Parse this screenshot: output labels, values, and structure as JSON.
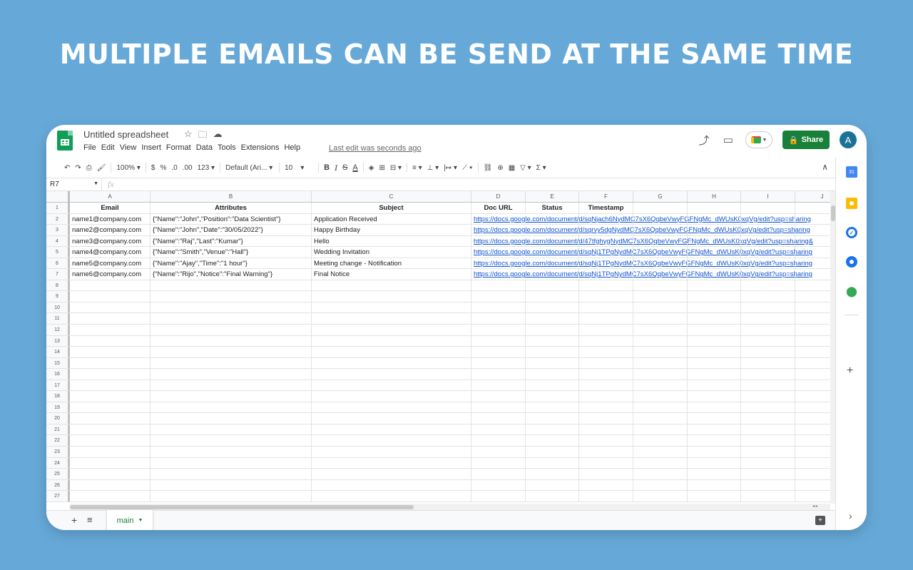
{
  "headline": "MULTIPLE EMAILS CAN BE SEND AT THE SAME TIME",
  "app": {
    "doc_title": "Untitled spreadsheet",
    "menu": [
      "File",
      "Edit",
      "View",
      "Insert",
      "Format",
      "Data",
      "Tools",
      "Extensions",
      "Help"
    ],
    "last_edit": "Last edit was seconds ago",
    "share_label": "Share",
    "avatar_letter": "A",
    "brand_green": "#188038"
  },
  "toolbar": {
    "zoom": "100%",
    "currency": "$",
    "percent": "%",
    "dec_decrease": ".0",
    "dec_increase": ".00",
    "format_more": "123",
    "font": "Default (Ari...",
    "font_size": "10",
    "bold": "B",
    "italic": "I",
    "strike": "S",
    "text_color": "A",
    "functions": "Σ"
  },
  "formula_bar": {
    "cell_ref": "R7",
    "fx": "fx"
  },
  "sheet": {
    "columns": [
      "A",
      "B",
      "C",
      "D",
      "E",
      "F",
      "G",
      "H",
      "I",
      "J"
    ],
    "headers": [
      "Email",
      "Attributes",
      "Subject",
      "Doc URL",
      "Status",
      "Timestamp"
    ],
    "rows": [
      [
        "name1@company.com",
        "{\"Name\":\"John\",\"Position\":\"Data Scientist\"}",
        "Application Received",
        "https://docs.google.com/document/d/sqNjach6NydMC7sX6QqbeVwyFGFNgMc_dWUsK0xqVg/edit?usp=sharing"
      ],
      [
        "name2@company.com",
        "{\"Name\":\"John\",\"Date\":\"30/05/2022\"}",
        "Happy Birthday",
        "https://docs.google.com/document/d/sqrvy5dgNydMC7sX6QqbeVwyFGFNgMc_dWUsK0xqVg/edit?usp=sharing"
      ],
      [
        "name3@company.com",
        "{\"Name\":\"Raj\",\"Last\":\"Kumar\"}",
        "Hello",
        "https://docs.google.com/document/d/47tfghygNydMC7sX6QqbeVwyFGFNgMc_dWUsK0xqVg/edit?usp=sharing&"
      ],
      [
        "name4@company.com",
        "{\"Name\":\"Smith\",\"Venue\":\"Hall\"}",
        "Wedding Invitation",
        "https://docs.google.com/document/d/sqNj1TPgNydMC7sX6QqbeVwyFGFNgMc_dWUsK0xqVg/edit?usp=sharing"
      ],
      [
        "name5@company.com",
        "{\"Name\":\"Ajay\",\"Time\":\"1 hour\"}",
        "Meeting change - Notification",
        "https://docs.google.com/document/d/sqNj1TPgNydMC7sX6QqbeVwyFGFNgMc_dWUsK0xqVg/edit?usp=sharing"
      ],
      [
        "name6@company.com",
        "{\"Name\":\"Rijo\",\"Notice\":\"Final Warning\"}",
        "Final Notice",
        "https://docs.google.com/document/d/sqNj1TPgNydMC7sX6QqbeVwyFGFNgMc_dWUsK0xqVg/edit?usp=sharing"
      ]
    ],
    "row_count": 27,
    "link_color": "#1155cc"
  },
  "bottom": {
    "tab_name": "main"
  }
}
